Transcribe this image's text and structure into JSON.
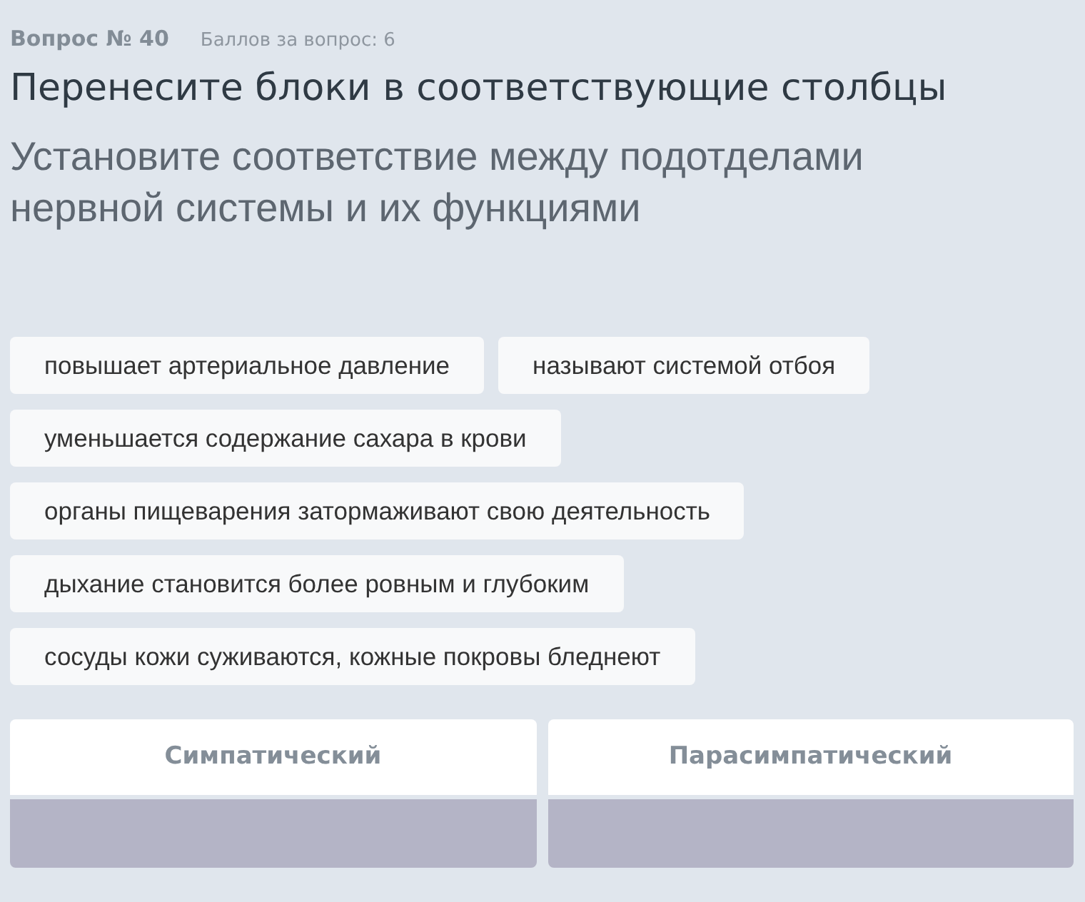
{
  "question": {
    "number": "Вопрос № 40",
    "points": "Баллов за вопрос: 6"
  },
  "title": "Перенесите блоки в соответствующие столбцы",
  "prompt": "Установите соответствие между подотделами нервной системы и их функциями",
  "blocks": [
    "повышает артериальное давление",
    "называют системой отбоя",
    "уменьшается содержание сахара в крови",
    "органы пищеварения затормаживают свою деятельность",
    "дыхание становится более ровным и глубоким",
    "сосуды кожи суживаются, кожные покровы бледнеют"
  ],
  "columns": [
    {
      "heading": "Симпатический"
    },
    {
      "heading": "Парасимпатический"
    }
  ]
}
